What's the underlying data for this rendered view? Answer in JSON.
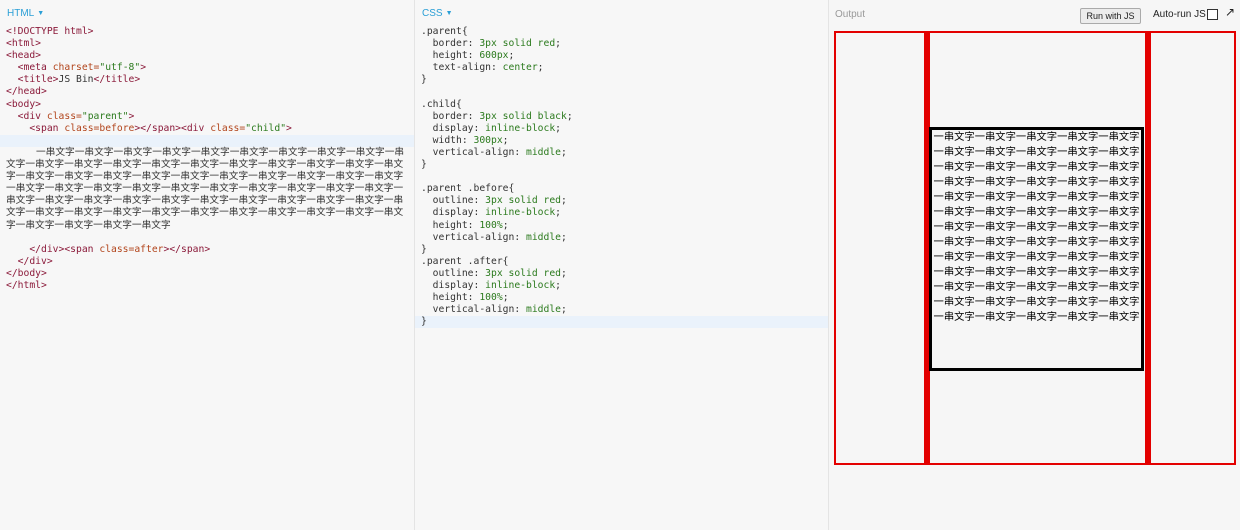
{
  "html_panel": {
    "label": "HTML",
    "caret": "▼",
    "lines": {
      "l1": "<!DOCTYPE html>",
      "l2": "<html>",
      "l3": "<head>",
      "l4_tag": "<meta",
      "l4_attr": "charset=",
      "l4_str": "\"utf-8\"",
      "l4_end": ">",
      "l5_open": "<title>",
      "l5_text": "JS Bin",
      "l5_close": "</title>",
      "l6": "</head>",
      "l7": "<body>",
      "l8_tag": "<div",
      "l8_attr": "class=",
      "l8_str": "\"parent\"",
      "l8_end": ">",
      "l9_tag1": "<span",
      "l9_attr1": "class=",
      "l9_val1": "before",
      "l9_mid": "></span><div",
      "l9_attr2": "class=",
      "l9_str2": "\"child\"",
      "l9_end": ">",
      "l10_text": "一串文字一串文字一串文字一串文字一串文字一串文字一串文字一串文字一串文字一串文字一串文字一串文字一串文字一串文字一串文字一串文字一串文字一串文字一串文字一串文字一串文字一串文字一串文字一串文字一串文字一串文字一串文字一串文字一串文字一串文字一串文字一串文字一串文字一串文字一串文字一串文字一串文字一串文字一串文字一串文字一串文字一串文字一串文字一串文字一串文字一串文字一串文字一串文字一串文字一串文字一串文字一串文字一串文字一串文字一串文字一串文字一串文字一串文字一串文字一串文字一串文字一串文字一串文字一串文字一串文字",
      "l11_tag1": "</div><span",
      "l11_attr": "class=",
      "l11_val": "after",
      "l11_end": "></span>",
      "l12": "</div>",
      "l13": "</body>",
      "l14": "</html>"
    }
  },
  "css_panel": {
    "label": "CSS",
    "caret": "▼",
    "rules": {
      "parent_sel": ".parent{",
      "parent_border_prop": "border: ",
      "parent_border_val": "3px solid red",
      "parent_height_prop": "height: ",
      "parent_height_val": "600px",
      "parent_align_prop": "text-align: ",
      "parent_align_val": "center",
      "close": "}",
      "child_sel": ".child{",
      "child_border_prop": "border: ",
      "child_border_val": "3px solid black",
      "child_display_prop": "display: ",
      "child_display_val": "inline-block",
      "child_width_prop": "width: ",
      "child_width_val": "300px",
      "child_valign_prop": "vertical-align: ",
      "child_valign_val": "middle",
      "before_sel": ".parent .before{",
      "outline_prop": "outline: ",
      "outline_val": "3px solid red",
      "display_prop": "display: ",
      "display_val": "inline-block",
      "height_prop": "height: ",
      "height_val": "100%",
      "valign_prop": "vertical-align: ",
      "valign_val": "middle",
      "after_sel": ".parent .after{"
    }
  },
  "output_panel": {
    "label": "Output",
    "run_button": "Run with JS",
    "autorun_label": "Auto-run JS",
    "popout_icon": "popout-arrow-icon",
    "child_text": "一串文字一串文字一串文字一串文字一串文字一串文字一串文字一串文字一串文字一串文字一串文字一串文字一串文字一串文字一串文字一串文字一串文字一串文字一串文字一串文字一串文字一串文字一串文字一串文字一串文字一串文字一串文字一串文字一串文字一串文字一串文字一串文字一串文字一串文字一串文字一串文字一串文字一串文字一串文字一串文字一串文字一串文字一串文字一串文字一串文字一串文字一串文字一串文字一串文字一串文字一串文字一串文字一串文字一串文字一串文字一串文字一串文字一串文字一串文字一串文字一串文字一串文字一串文字一串文字一串文字"
  },
  "colors": {
    "accent": "#2a9fd6",
    "outline_red": "#e30000",
    "child_border": "#000000"
  }
}
